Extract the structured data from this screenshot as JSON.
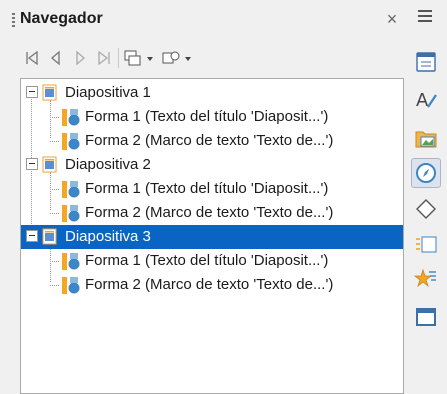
{
  "panel": {
    "title": "Navegador",
    "close_glyph": "×"
  },
  "toolbar": [
    {
      "name": "first-slide-icon"
    },
    {
      "name": "previous-slide-icon"
    },
    {
      "name": "next-slide-icon"
    },
    {
      "name": "last-slide-icon"
    },
    {
      "name": "drag-mode-icon"
    },
    {
      "name": "shapes-filter-icon"
    }
  ],
  "tree": {
    "slides": [
      {
        "label": "Diapositiva 1",
        "selected": false,
        "children": [
          {
            "label": "Forma 1 (Texto del título 'Diaposit...')"
          },
          {
            "label": "Forma 2 (Marco de texto 'Texto de...')"
          }
        ]
      },
      {
        "label": "Diapositiva 2",
        "selected": false,
        "children": [
          {
            "label": "Forma 1 (Texto del título 'Diaposit...')"
          },
          {
            "label": "Forma 2 (Marco de texto 'Texto de...')"
          }
        ]
      },
      {
        "label": "Diapositiva 3",
        "selected": true,
        "children": [
          {
            "label": "Forma 1 (Texto del título 'Diaposit...')"
          },
          {
            "label": "Forma 2 (Marco de texto 'Texto de...')"
          }
        ]
      }
    ]
  },
  "sidebar": {
    "items": [
      {
        "name": "properties-icon",
        "active": false
      },
      {
        "name": "styles-icon",
        "active": false
      },
      {
        "name": "gallery-icon",
        "active": false
      },
      {
        "name": "navigator-icon",
        "active": true
      },
      {
        "name": "shapes-icon",
        "active": false
      },
      {
        "name": "slide-transition-icon",
        "active": false
      },
      {
        "name": "animation-icon",
        "active": false
      },
      {
        "name": "master-slides-icon",
        "active": false
      }
    ]
  },
  "colors": {
    "selection": "#0a64c4",
    "shape_blue": "#3d85c6",
    "shape_orange": "#f5a623"
  }
}
